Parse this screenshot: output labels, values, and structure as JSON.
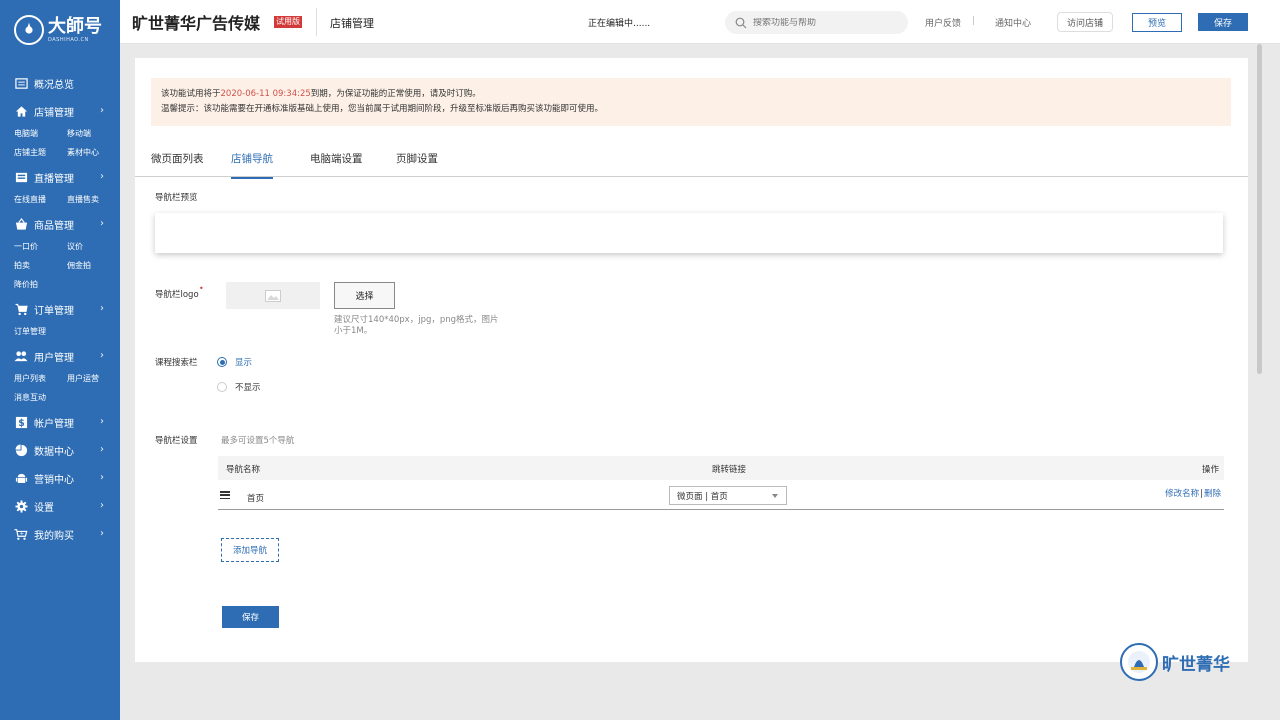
{
  "brand": {
    "name": "大師号",
    "sub": "DASHIHAO.CN"
  },
  "sidebar": {
    "groups": [
      {
        "label": "概况总览",
        "icon": "dashboard-icon",
        "has_chevron": false,
        "subs": []
      },
      {
        "label": "店铺管理",
        "icon": "home-icon",
        "has_chevron": true,
        "subs": [
          "电脑端",
          "移动端",
          "店铺主题",
          "素材中心"
        ]
      },
      {
        "label": "直播管理",
        "icon": "video-icon",
        "has_chevron": true,
        "subs": [
          "在线直播",
          "直播售卖"
        ]
      },
      {
        "label": "商品管理",
        "icon": "basket-icon",
        "has_chevron": true,
        "subs": [
          "一口价",
          "议价",
          "拍卖",
          "佣金拍",
          "降价拍"
        ]
      },
      {
        "label": "订单管理",
        "icon": "cart-icon",
        "has_chevron": true,
        "subs": [
          "订单管理"
        ]
      },
      {
        "label": "用户管理",
        "icon": "users-icon",
        "has_chevron": true,
        "subs": [
          "用户列表",
          "用户运营",
          "消息互动"
        ]
      },
      {
        "label": "帐户管理",
        "icon": "dollar-icon",
        "has_chevron": true,
        "subs": []
      },
      {
        "label": "数据中心",
        "icon": "pie-chart-icon",
        "has_chevron": true,
        "subs": []
      },
      {
        "label": "营销中心",
        "icon": "android-icon",
        "has_chevron": true,
        "subs": []
      },
      {
        "label": "设置",
        "icon": "gear-icon",
        "has_chevron": true,
        "subs": []
      },
      {
        "label": "我的购买",
        "icon": "shopping-cart-icon",
        "has_chevron": true,
        "subs": []
      }
    ]
  },
  "header": {
    "store_title": "旷世菁华广告传媒",
    "trial_badge": "试用版",
    "section": "店铺管理",
    "editing_status": "正在编辑中......",
    "search_placeholder": "搜索功能与帮助",
    "feedback": "用户反馈",
    "notifications": "通知中心",
    "visit_store": "访问店铺",
    "preview": "预览",
    "save": "保存"
  },
  "notice": {
    "line1_prefix": "该功能试用将于",
    "line1_date": "2020-06-11 09:34:25",
    "line1_suffix": "到期，为保证功能的正常使用，请及时订购。",
    "line2": "温馨提示：该功能需要在开通标准版基础上使用，您当前属于试用期间阶段，升级至标准版后再购买该功能即可使用。"
  },
  "tabs": [
    {
      "label": "微页面列表",
      "active": false
    },
    {
      "label": "店铺导航",
      "active": true
    },
    {
      "label": "电脑端设置",
      "active": false
    },
    {
      "label": "页脚设置",
      "active": false
    }
  ],
  "form": {
    "preview_label": "导航栏预览",
    "logo_label": "导航栏logo",
    "required_mark": "•",
    "choose_button": "选择",
    "logo_hint": "建议尺寸140*40px，jpg，png格式，图片小于1M。",
    "search_bar_label": "课程搜索栏",
    "search_bar_options": [
      {
        "label": "显示",
        "selected": true
      },
      {
        "label": "不显示",
        "selected": false
      }
    ],
    "nav_settings_label": "导航栏设置",
    "nav_settings_hint": "最多可设置5个导航",
    "table_headers": {
      "name": "导航名称",
      "link": "跳转链接",
      "ops": "操作"
    },
    "rows": [
      {
        "name": "首页",
        "link_value": "微页面 | 首页",
        "op_edit": "修改名称",
        "op_sep": "|",
        "op_delete": "删除"
      }
    ],
    "add_nav_button": "添加导航",
    "save_button": "保存"
  },
  "watermark": {
    "text": "旷世菁华"
  },
  "colors": {
    "primary": "#2e6db4",
    "alert_bg": "#fdf1e7",
    "alert_date": "#d0514a",
    "badge": "#d23a3a"
  }
}
